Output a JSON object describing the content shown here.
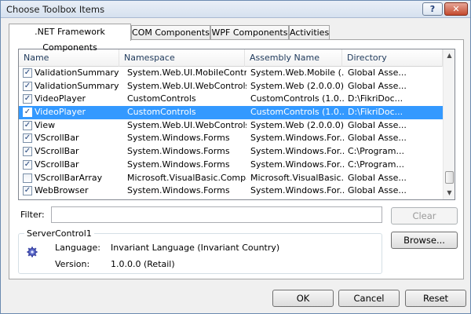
{
  "window": {
    "title": "Choose Toolbox Items",
    "help_label": "?",
    "close_label": "✕"
  },
  "tabs": [
    {
      "label": ".NET Framework Components",
      "active": true
    },
    {
      "label": "COM Components",
      "active": false
    },
    {
      "label": "WPF Components",
      "active": false
    },
    {
      "label": "Activities",
      "active": false
    }
  ],
  "table": {
    "columns": [
      "Name",
      "Namespace",
      "Assembly Name",
      "Directory"
    ],
    "rows": [
      {
        "checked": true,
        "name": "ValidationSummary",
        "namespace": "System.Web.UI.MobileContr...",
        "assembly": "System.Web.Mobile (...",
        "directory": "Global Asse...",
        "selected": false
      },
      {
        "checked": true,
        "name": "ValidationSummary",
        "namespace": "System.Web.UI.WebControls",
        "assembly": "System.Web (2.0.0.0)",
        "directory": "Global Asse...",
        "selected": false
      },
      {
        "checked": true,
        "name": "VideoPlayer",
        "namespace": "CustomControls",
        "assembly": "CustomControls (1.0....",
        "directory": "D:\\FikriDoc...",
        "selected": false
      },
      {
        "checked": true,
        "name": "VideoPlayer",
        "namespace": "CustomControls",
        "assembly": "CustomControls (1.0....",
        "directory": "D:\\FikriDoc...",
        "selected": true
      },
      {
        "checked": true,
        "name": "View",
        "namespace": "System.Web.UI.WebControls",
        "assembly": "System.Web (2.0.0.0)",
        "directory": "Global Asse...",
        "selected": false
      },
      {
        "checked": true,
        "name": "VScrollBar",
        "namespace": "System.Windows.Forms",
        "assembly": "System.Windows.For...",
        "directory": "Global Asse...",
        "selected": false
      },
      {
        "checked": true,
        "name": "VScrollBar",
        "namespace": "System.Windows.Forms",
        "assembly": "System.Windows.For...",
        "directory": "C:\\Program...",
        "selected": false
      },
      {
        "checked": true,
        "name": "VScrollBar",
        "namespace": "System.Windows.Forms",
        "assembly": "System.Windows.For...",
        "directory": "C:\\Program...",
        "selected": false
      },
      {
        "checked": false,
        "name": "VScrollBarArray",
        "namespace": "Microsoft.VisualBasic.Compa...",
        "assembly": "Microsoft.VisualBasic....",
        "directory": "Global Asse...",
        "selected": false
      },
      {
        "checked": true,
        "name": "WebBrowser",
        "namespace": "System.Windows.Forms",
        "assembly": "System.Windows.For...",
        "directory": "Global Asse...",
        "selected": false
      }
    ]
  },
  "filter": {
    "label": "Filter:",
    "value": "",
    "placeholder": ""
  },
  "buttons": {
    "clear": "Clear",
    "browse": "Browse...",
    "ok": "OK",
    "cancel": "Cancel",
    "reset": "Reset"
  },
  "details": {
    "group_title": "ServerControl1",
    "icon": "gear-icon",
    "language_label": "Language:",
    "language_value": "Invariant Language (Invariant Country)",
    "version_label": "Version:",
    "version_value": "1.0.0.0 (Retail)"
  },
  "colors": {
    "selection": "#3399ff",
    "title_bar": "#d6e1ef",
    "close_button": "#c44a2f"
  }
}
